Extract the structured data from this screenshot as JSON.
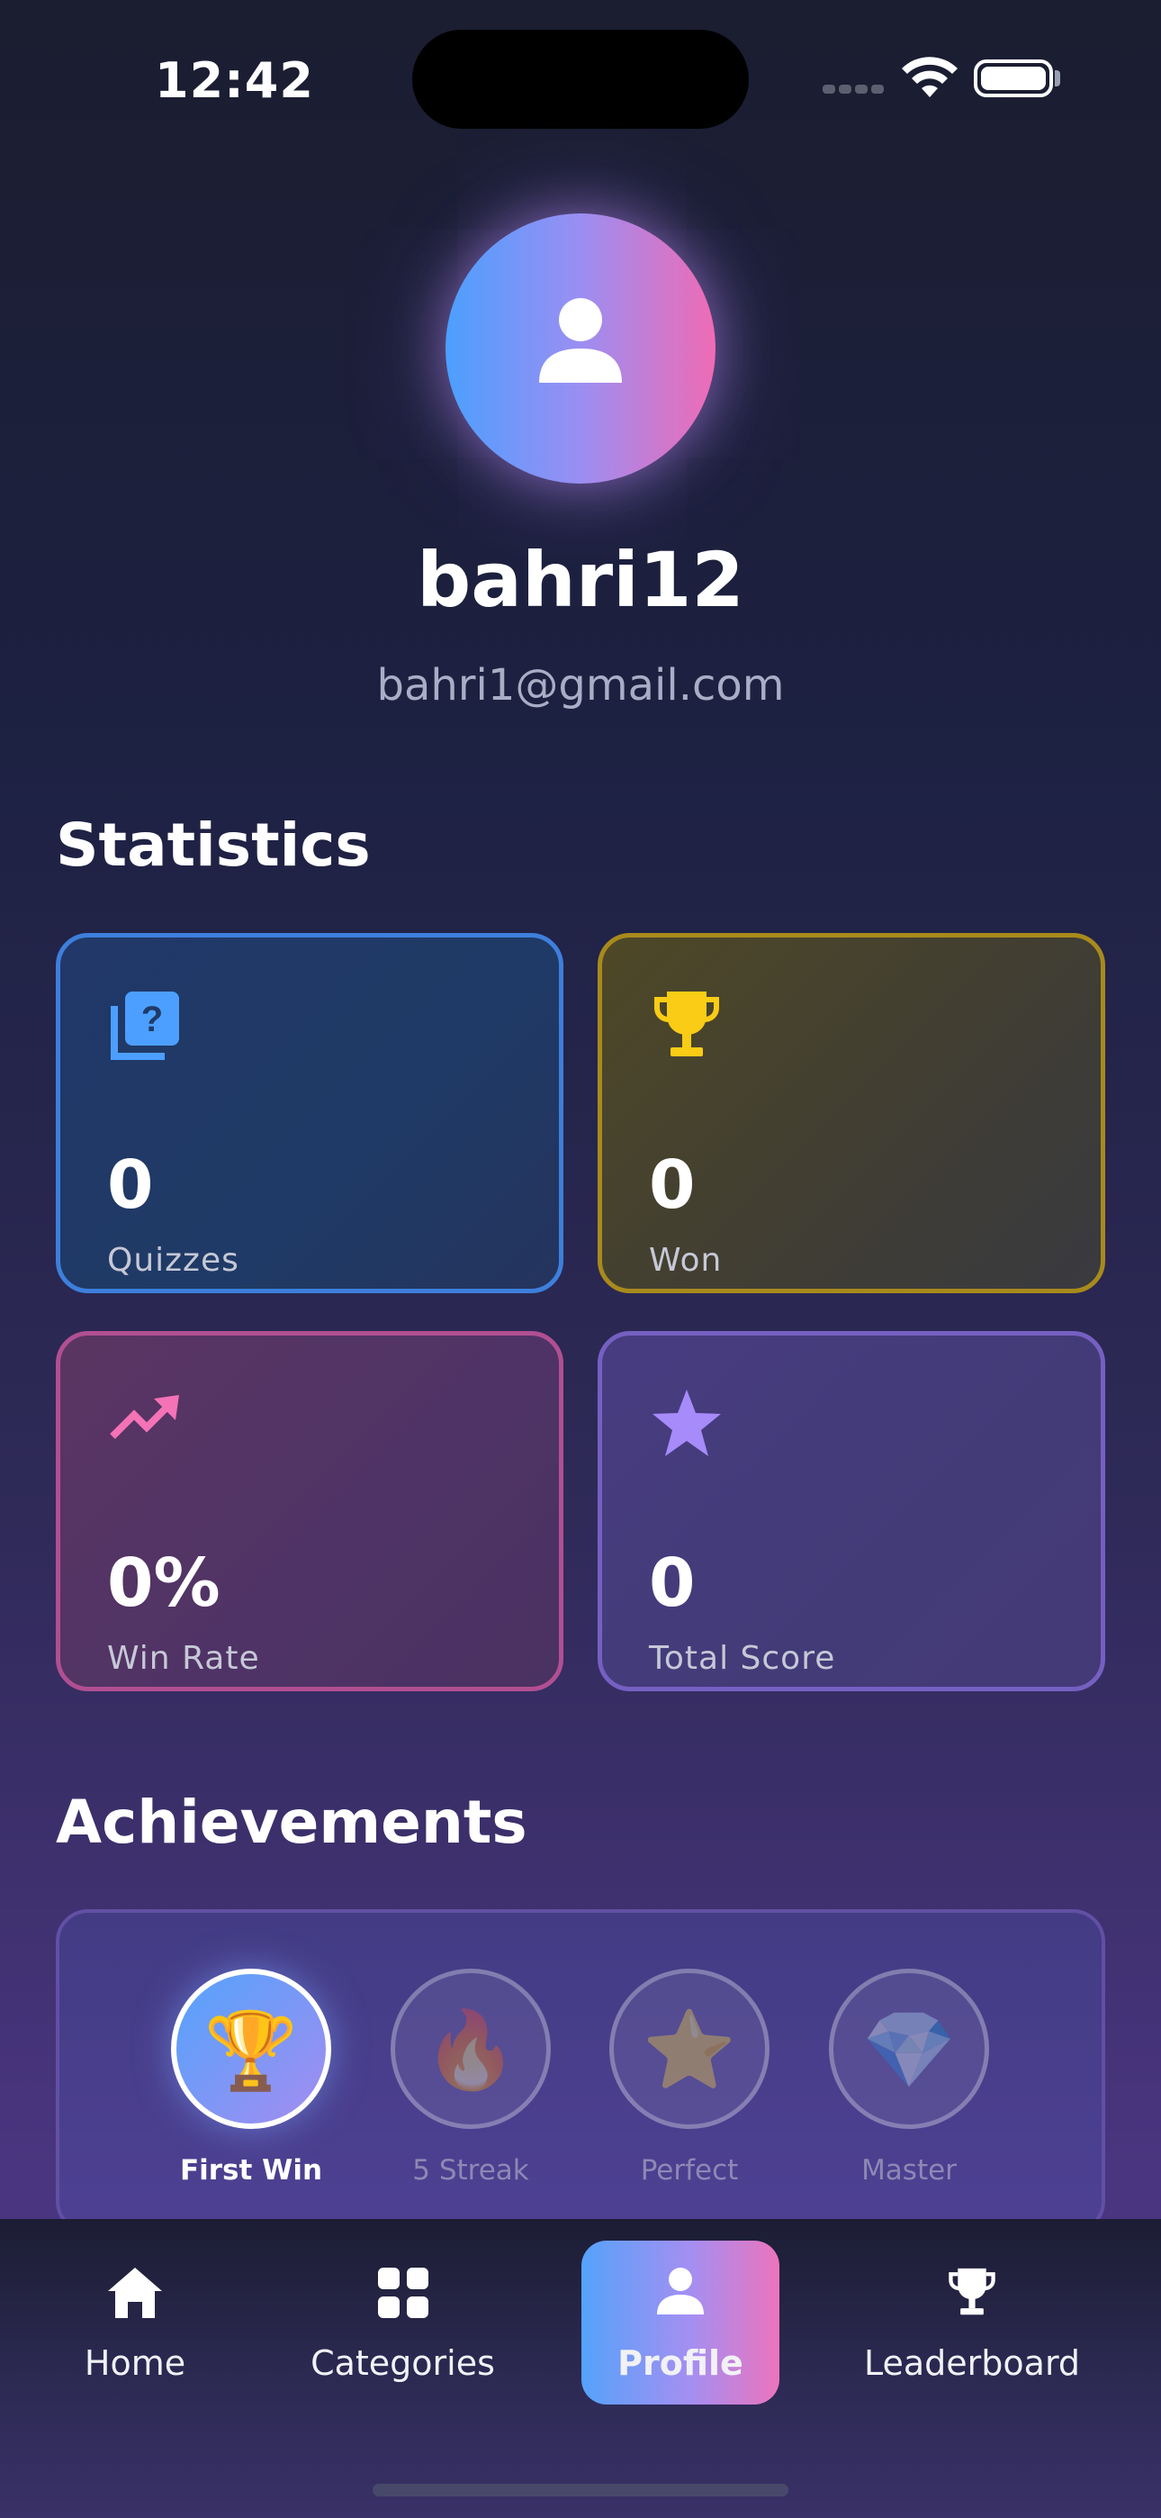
{
  "status_bar": {
    "time": "12:42"
  },
  "profile": {
    "username": "bahri12",
    "email": "bahri1@gmail.com"
  },
  "statistics": {
    "title": "Statistics",
    "cards": [
      {
        "icon": "quiz-icon",
        "value": "0",
        "label": "Quizzes",
        "color": "#3d7fdc"
      },
      {
        "icon": "trophy-icon",
        "value": "0",
        "label": "Won",
        "color": "#ffcc00"
      },
      {
        "icon": "trending-up-icon",
        "value": "0%",
        "label": "Win Rate",
        "color": "#f472b6"
      },
      {
        "icon": "star-icon",
        "value": "0",
        "label": "Total Score",
        "color": "#a78bfa"
      }
    ]
  },
  "achievements": {
    "title": "Achievements",
    "badges": [
      {
        "emoji": "🏆",
        "label": "First Win",
        "unlocked": true
      },
      {
        "emoji": "🔥",
        "label": "5 Streak",
        "unlocked": false
      },
      {
        "emoji": "⭐",
        "label": "Perfect",
        "unlocked": false
      },
      {
        "emoji": "💎",
        "label": "Master",
        "unlocked": false
      }
    ]
  },
  "nav": {
    "items": [
      {
        "label": "Home",
        "icon": "home-icon"
      },
      {
        "label": "Categories",
        "icon": "grid-icon"
      },
      {
        "label": "Profile",
        "icon": "person-icon",
        "active": true
      },
      {
        "label": "Leaderboard",
        "icon": "trophy-icon"
      }
    ]
  }
}
